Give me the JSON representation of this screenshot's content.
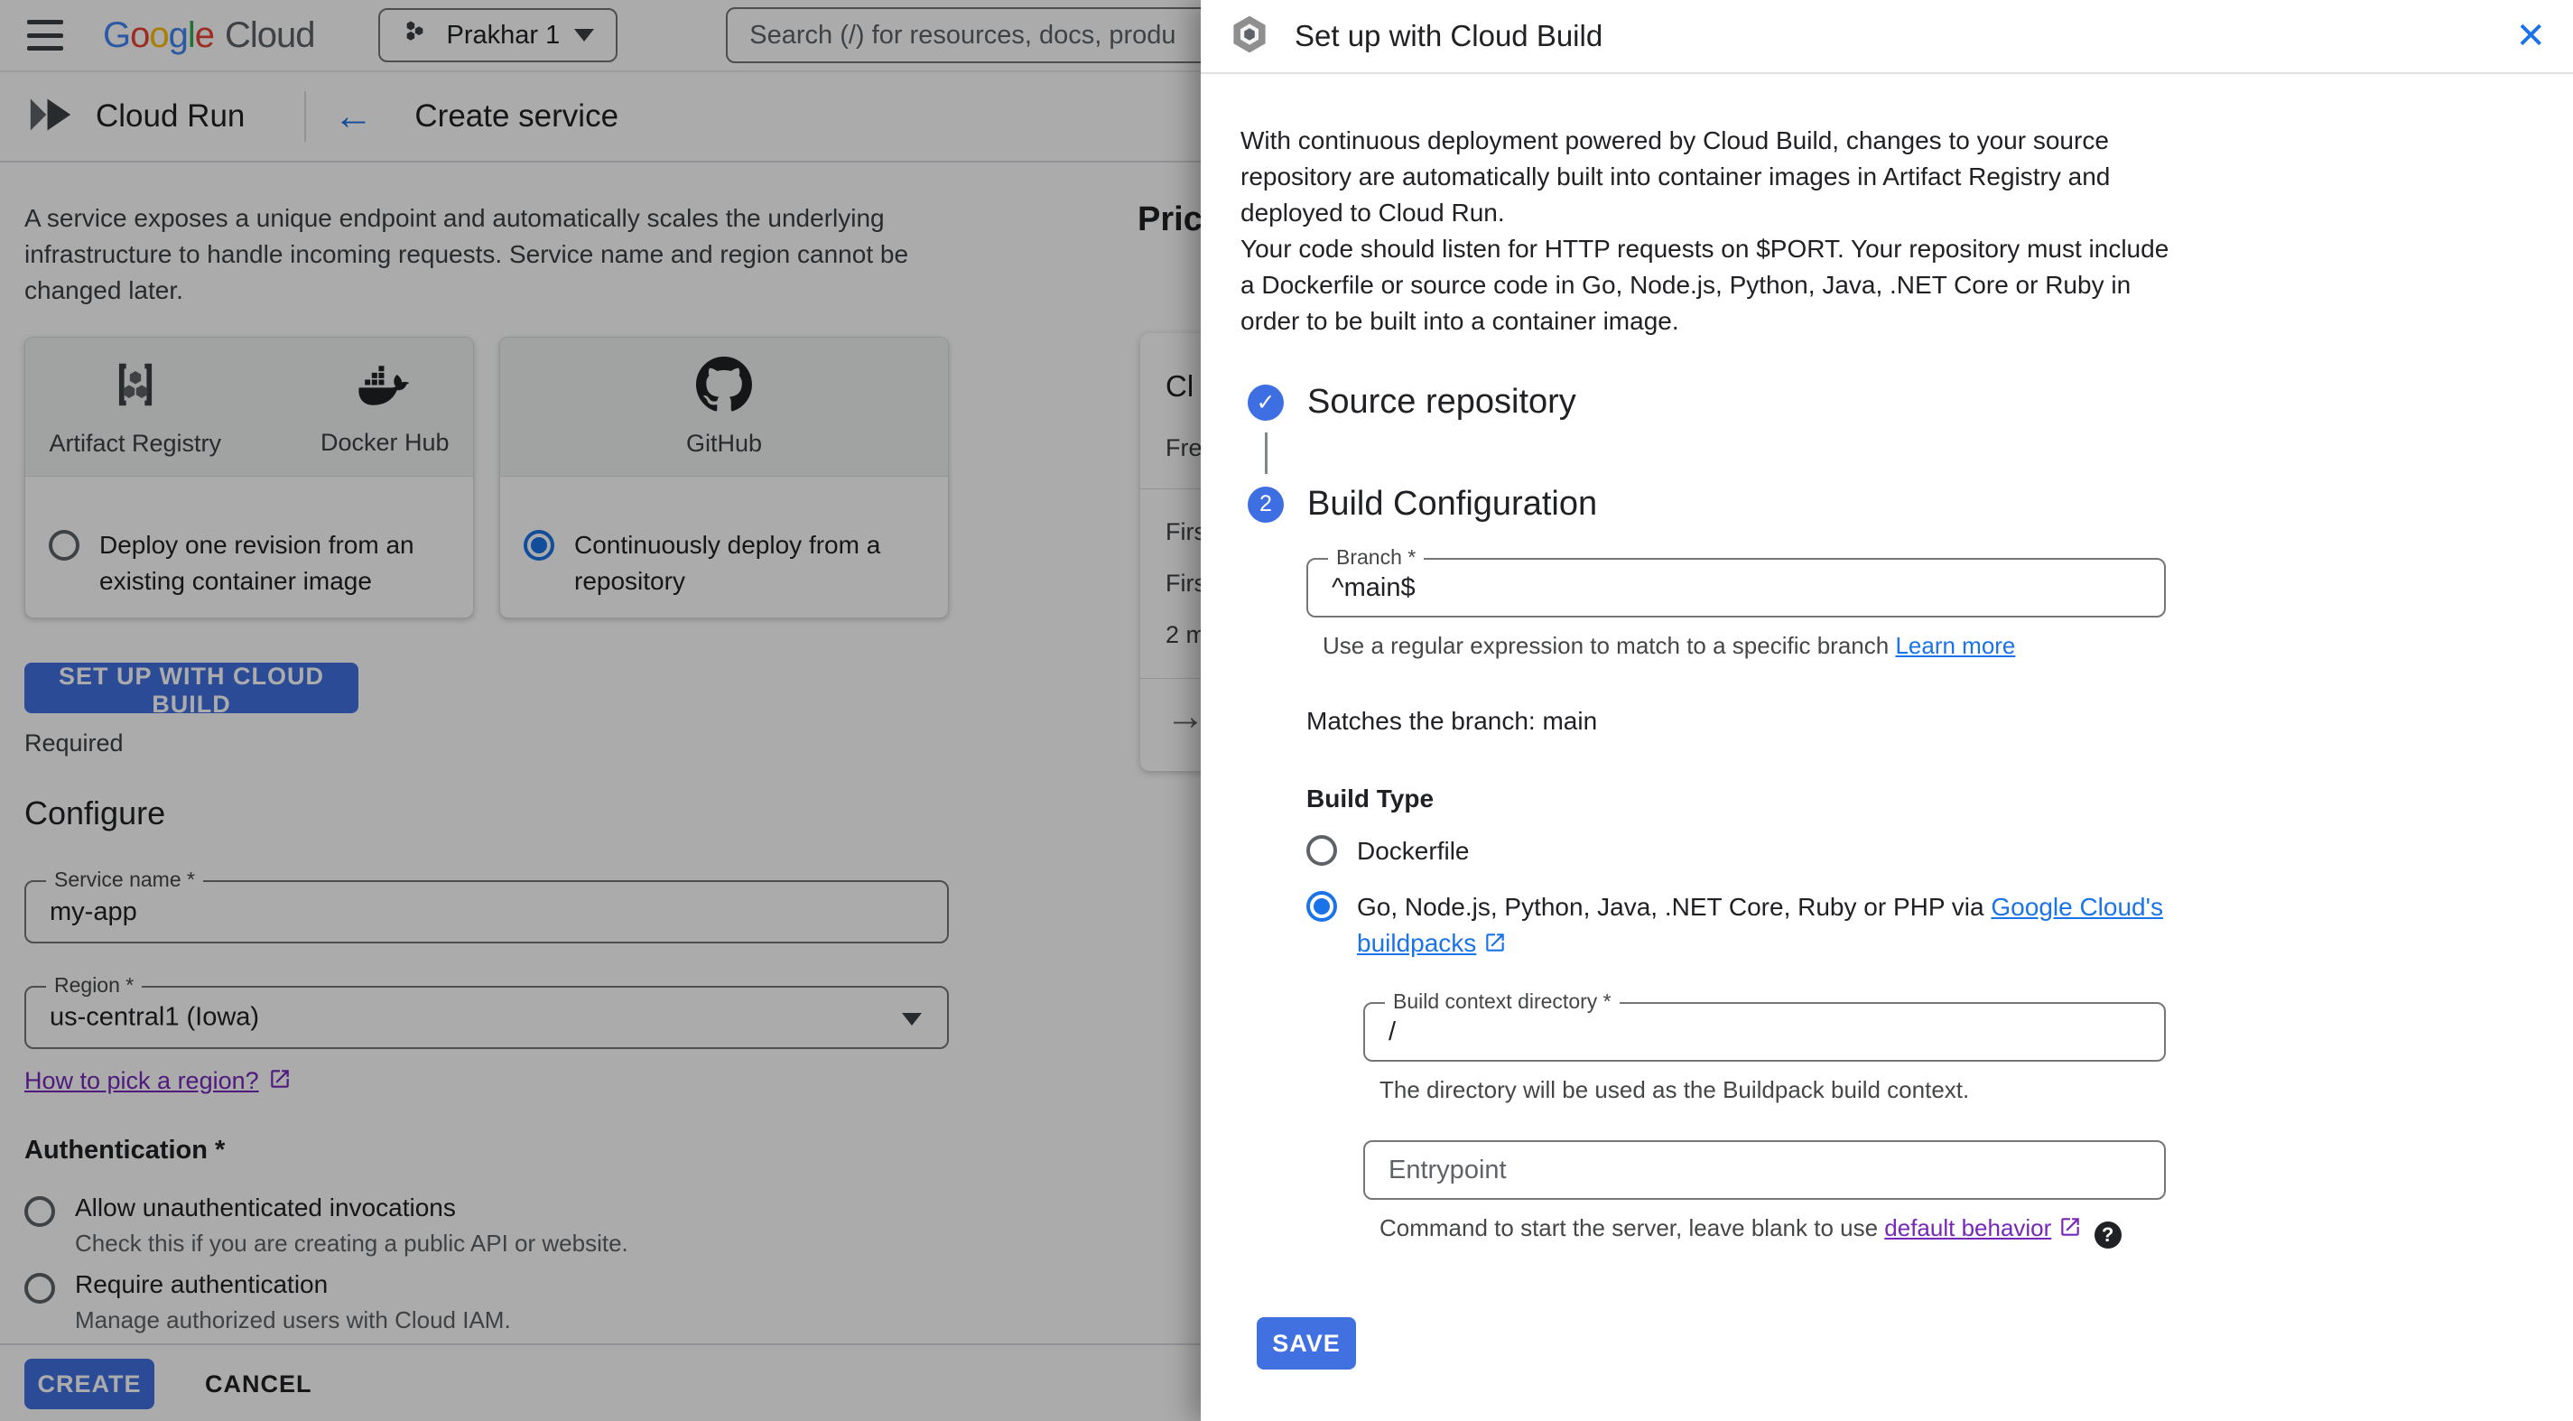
{
  "colors": {
    "accent": "#1a73e8",
    "button_blue": "#4170e0",
    "link_purple": "#7627bb",
    "scrim": "rgba(0,0,0,0.33)"
  },
  "topbar": {
    "brand": {
      "g1": "G",
      "g2": "o",
      "g3": "o",
      "g4": "g",
      "g5": "l",
      "g6": "e",
      "cloud": "Cloud"
    },
    "project_name": "Prakhar 1",
    "search_placeholder": "Search (/) for resources, docs, produ"
  },
  "header": {
    "product": "Cloud Run",
    "back_arrow": "←",
    "title": "Create service"
  },
  "main": {
    "intro": "A service exposes a unique endpoint and automatically scales the underlying infrastructure to handle incoming requests. Service name and region cannot be changed later.",
    "cards": [
      {
        "sources": [
          {
            "label": "Artifact Registry"
          },
          {
            "label": "Docker Hub"
          }
        ],
        "option": "Deploy one revision from an existing container image",
        "selected": false
      },
      {
        "sources": [
          {
            "label": "GitHub"
          }
        ],
        "option": "Continuously deploy from a repository",
        "selected": true
      }
    ],
    "setup_button": "SET UP WITH CLOUD BUILD",
    "required_note": "Required",
    "configure_heading": "Configure",
    "service_name": {
      "label": "Service name *",
      "value": "my-app"
    },
    "region": {
      "label": "Region *",
      "value": "us-central1 (Iowa)"
    },
    "region_link": "How to pick a region?",
    "auth_heading": "Authentication *",
    "auth_options": [
      {
        "label": "Allow unauthenticated invocations",
        "helper": "Check this if you are creating a public API or website.",
        "selected": false
      },
      {
        "label": "Require authentication",
        "helper": "Manage authorized users with Cloud IAM.",
        "selected": false
      }
    ],
    "create_button": "CREATE",
    "cancel_button": "CANCEL"
  },
  "pricing": {
    "heading": "Pric",
    "card": {
      "title": "Cl",
      "subtitle": "Fre",
      "row1": "Firs",
      "row2": "Firs",
      "row3": "2 m",
      "arrow": "→"
    }
  },
  "panel": {
    "title": "Set up with Cloud Build",
    "intro1": "With continuous deployment powered by Cloud Build, changes to your source repository are automatically built into container images in Artifact Registry and deployed to Cloud Run.",
    "intro2": "Your code should listen for HTTP requests on $PORT. Your repository must include a Dockerfile or source code in Go, Node.js, Python, Java, .NET Core or Ruby in order to be built into a container image.",
    "close_glyph": "✕",
    "step1": {
      "title": "Source repository",
      "check": "✓"
    },
    "step2": {
      "number": "2",
      "title": "Build Configuration"
    },
    "branch": {
      "label": "Branch *",
      "value": "^main$",
      "helper": "Use a regular expression to match to a specific branch ",
      "helper_link": "Learn more"
    },
    "matches_text": "Matches the branch: main",
    "build_type_label": "Build Type",
    "build_type_options": [
      {
        "label": "Dockerfile",
        "selected": false
      },
      {
        "label_prefix": "Go, Node.js, Python, Java, .NET Core, Ruby or PHP via ",
        "link": "Google Cloud's buildpacks",
        "selected": true
      }
    ],
    "context_dir": {
      "label": "Build context directory *",
      "value": "/",
      "helper": "The directory will be used as the Buildpack build context."
    },
    "entrypoint": {
      "placeholder": "Entrypoint",
      "helper": "Command to start the server, leave blank to use ",
      "helper_link": "default behavior",
      "help_glyph": "?"
    },
    "save_button": "SAVE"
  }
}
